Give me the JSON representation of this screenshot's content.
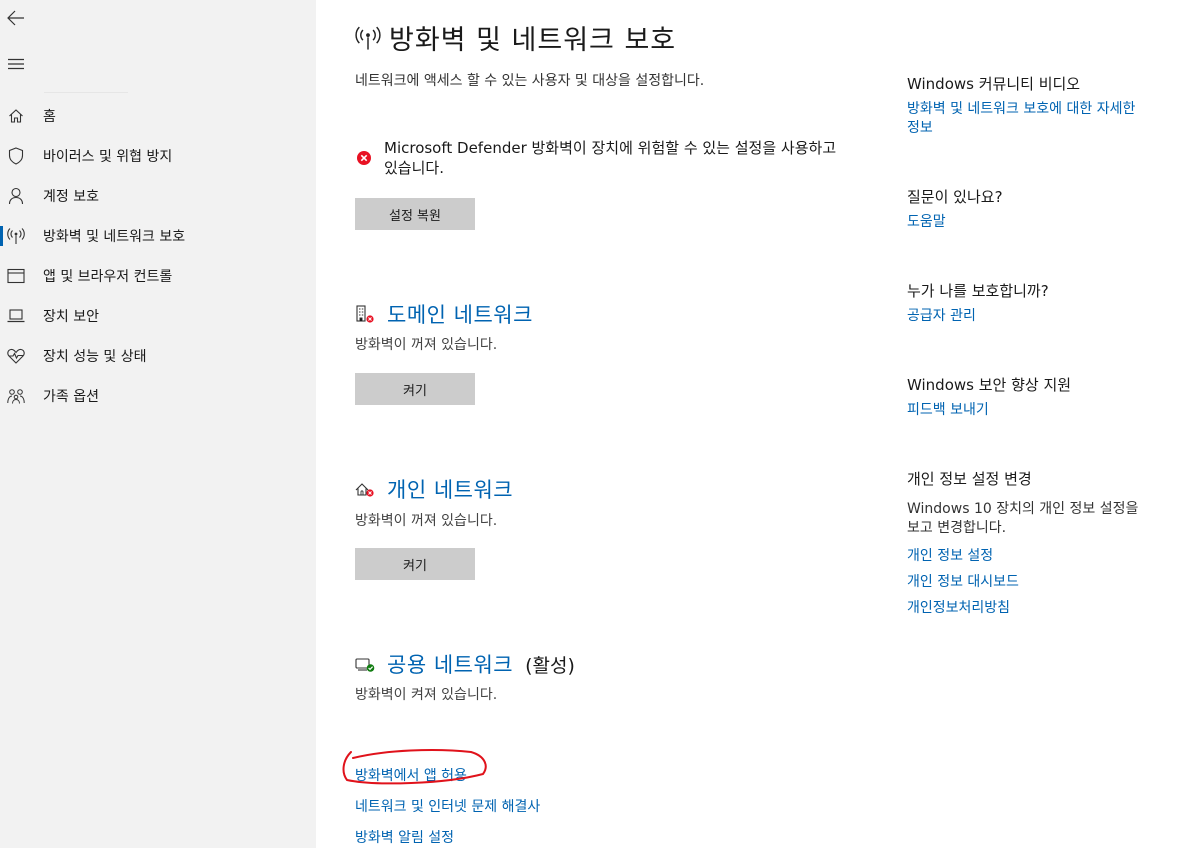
{
  "sidebar": {
    "items": [
      {
        "label": "홈",
        "icon": "home-icon"
      },
      {
        "label": "바이러스 및 위협 방지",
        "icon": "shield-icon"
      },
      {
        "label": "계정 보호",
        "icon": "person-icon"
      },
      {
        "label": "방화벽 및 네트워크 보호",
        "icon": "antenna-icon"
      },
      {
        "label": "앱 및 브라우저 컨트롤",
        "icon": "app-window-icon"
      },
      {
        "label": "장치 보안",
        "icon": "laptop-icon"
      },
      {
        "label": "장치 성능 및 상태",
        "icon": "heart-pulse-icon"
      },
      {
        "label": "가족 옵션",
        "icon": "family-icon"
      }
    ],
    "active_index": 3
  },
  "main": {
    "title": "방화벽 및 네트워크 보호",
    "subtitle": "네트워크에 액세스 할 수 있는 사용자 및 대상을 설정합니다.",
    "alert_text": "Microsoft Defender 방화벽이 장치에 위험할 수 있는 설정을 사용하고 있습니다.",
    "restore_button": "설정 복원",
    "networks": [
      {
        "name": "도메인 네트워크",
        "extra": "",
        "status": "방화벽이 꺼져 있습니다.",
        "button": "켜기",
        "icon": "domain-network-icon"
      },
      {
        "name": "개인 네트워크",
        "extra": "",
        "status": "방화벽이 꺼져 있습니다.",
        "button": "켜기",
        "icon": "private-network-icon"
      },
      {
        "name": "공용 네트워크",
        "extra": "(활성)",
        "status": "방화벽이 켜져 있습니다.",
        "button": "",
        "icon": "public-network-icon"
      }
    ],
    "links": [
      "방화벽에서 앱 허용",
      "네트워크 및 인터넷 문제 해결사",
      "방화벽 알림 설정"
    ]
  },
  "right": {
    "community_title": "Windows 커뮤니티 비디오",
    "community_link": "방화벽 및 네트워크 보호에 대한 자세한 정보",
    "question_title": "질문이 있나요?",
    "help_link": "도움말",
    "who_title": "누가 나를 보호합니까?",
    "provider_link": "공급자 관리",
    "improve_title": "Windows 보안 향상 지원",
    "feedback_link": "피드백 보내기",
    "privacy_title": "개인 정보 설정 변경",
    "privacy_text": "Windows 10 장치의 개인 정보 설정을 보고 변경합니다.",
    "privacy_links": [
      "개인 정보 설정",
      "개인 정보 대시보드",
      "개인정보처리방침"
    ]
  },
  "colors": {
    "accent": "#0063b1",
    "sidebar_bg": "#f2f2f2",
    "button_bg": "#cccccc",
    "error_red": "#e81123",
    "ok_green": "#107c10",
    "annotation_red": "#e0121b"
  }
}
